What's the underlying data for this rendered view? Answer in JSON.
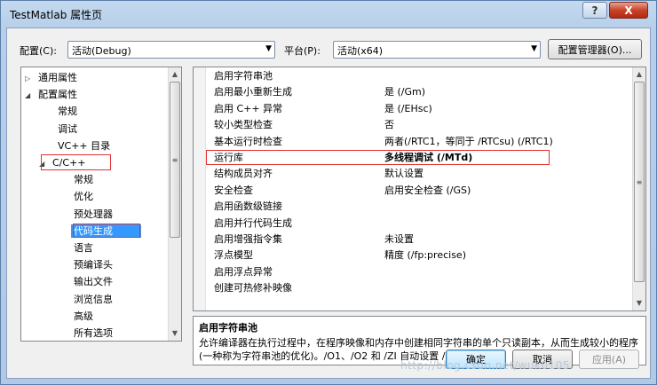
{
  "window": {
    "title": "TestMatlab 属性页",
    "help_label": "?",
    "close_label": "X"
  },
  "toolbar": {
    "config_label": "配置(C):",
    "config_value": "活动(Debug)",
    "platform_label": "平台(P):",
    "platform_value": "活动(x64)",
    "config_manager_label": "配置管理器(O)..."
  },
  "tree": {
    "items": [
      {
        "label": "通用属性",
        "toggle": "▷"
      },
      {
        "label": "配置属性",
        "toggle": "◢"
      },
      {
        "label": "常规"
      },
      {
        "label": "调试"
      },
      {
        "label": "VC++ 目录"
      },
      {
        "label": "C/C++",
        "toggle": "◢"
      },
      {
        "label": "常规"
      },
      {
        "label": "优化"
      },
      {
        "label": "预处理器"
      },
      {
        "label": "代码生成"
      },
      {
        "label": "语言"
      },
      {
        "label": "预编译头"
      },
      {
        "label": "输出文件"
      },
      {
        "label": "浏览信息"
      },
      {
        "label": "高级"
      },
      {
        "label": "所有选项"
      }
    ]
  },
  "properties": {
    "rows": [
      {
        "name": "启用字符串池",
        "value": ""
      },
      {
        "name": "启用最小重新生成",
        "value": "是 (/Gm)"
      },
      {
        "name": "启用 C++ 异常",
        "value": "是 (/EHsc)"
      },
      {
        "name": "较小类型检查",
        "value": "否"
      },
      {
        "name": "基本运行时检查",
        "value": "两者(/RTC1，等同于 /RTCsu) (/RTC1)"
      },
      {
        "name": "运行库",
        "value": "多线程调试 (/MTd)"
      },
      {
        "name": "结构成员对齐",
        "value": "默认设置"
      },
      {
        "name": "安全检查",
        "value": "启用安全检查 (/GS)"
      },
      {
        "name": "启用函数级链接",
        "value": ""
      },
      {
        "name": "启用并行代码生成",
        "value": ""
      },
      {
        "name": "启用增强指令集",
        "value": "未设置"
      },
      {
        "name": "浮点模型",
        "value": "精度 (/fp:precise)"
      },
      {
        "name": "启用浮点异常",
        "value": ""
      },
      {
        "name": "创建可热修补映像",
        "value": ""
      }
    ]
  },
  "description": {
    "title": "启用字符串池",
    "text": "允许编译器在执行过程中，在程序映像和内存中创建相同字符串的单个只读副本，从而生成较小的程序(一种称为字符串池的优化)。/O1、/O2 和 /ZI 自动设置 /GF 选项。"
  },
  "buttons": {
    "ok": "确定",
    "cancel": "取消",
    "apply": "应用(A)"
  },
  "watermark": "http://blog.csdn.net/wuk0105",
  "icons": {
    "combo_arrow": "▼",
    "scroll_up": "▲",
    "scroll_down": "▼",
    "grip": "≡"
  }
}
